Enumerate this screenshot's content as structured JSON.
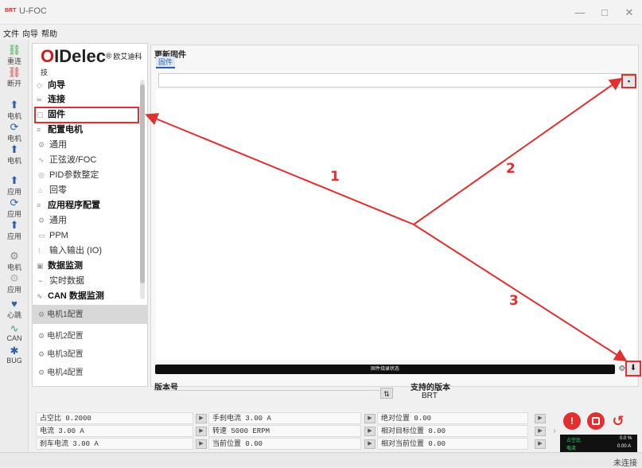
{
  "window": {
    "logo": "BRT",
    "title": "U-FOC",
    "minimize": "—",
    "maximize": "□",
    "close": "✕"
  },
  "menu": [
    "文件",
    "向导",
    "帮助"
  ],
  "toolbar": [
    {
      "icon": "link-icon",
      "glyph": "⛓",
      "label": "重连"
    },
    {
      "icon": "unlink-icon",
      "glyph": "⛓",
      "label": "断开"
    },
    {
      "icon": "upload-icon",
      "glyph": "⬆",
      "label": "电机"
    },
    {
      "icon": "refresh-icon",
      "glyph": "⟳",
      "label": "电机"
    },
    {
      "icon": "upload-icon",
      "glyph": "⬆",
      "label": "电机"
    },
    {
      "icon": "upload-icon",
      "glyph": "⬆",
      "label": "应用"
    },
    {
      "icon": "refresh-icon",
      "glyph": "⟳",
      "label": "应用"
    },
    {
      "icon": "upload-icon",
      "glyph": "⬆",
      "label": "应用"
    },
    {
      "icon": "motor-icon",
      "glyph": "⚙",
      "label": "电机"
    },
    {
      "icon": "app-icon",
      "glyph": "⚙",
      "label": "应用"
    },
    {
      "icon": "heart-icon",
      "glyph": "♥",
      "label": "心跳"
    },
    {
      "icon": "can-icon",
      "glyph": "∿",
      "label": "CAN"
    },
    {
      "icon": "bug-icon",
      "glyph": "✱",
      "label": "BUG"
    }
  ],
  "brand": {
    "name_first": "O",
    "name_rest": "IDelec",
    "reg": "®",
    "cn": "欧艾迪科技"
  },
  "nav": [
    {
      "label": "向导",
      "bold": true,
      "glyph": "◇"
    },
    {
      "label": "连接",
      "bold": true,
      "glyph": "∞"
    },
    {
      "label": "固件",
      "bold": true,
      "glyph": "▢"
    },
    {
      "label": "配置电机",
      "bold": true,
      "glyph": "≡"
    },
    {
      "label": "通用",
      "bold": false,
      "glyph": "⚙"
    },
    {
      "label": "正弦波/FOC",
      "bold": false,
      "glyph": "∿"
    },
    {
      "label": "PID参数整定",
      "bold": false,
      "glyph": "◎"
    },
    {
      "label": "回零",
      "bold": false,
      "glyph": "⌂"
    },
    {
      "label": "应用程序配置",
      "bold": true,
      "glyph": "≡"
    },
    {
      "label": "通用",
      "bold": false,
      "glyph": "⚙"
    },
    {
      "label": "PPM",
      "bold": false,
      "glyph": "▭"
    },
    {
      "label": "输入输出 (IO)",
      "bold": false,
      "glyph": "⁞"
    },
    {
      "label": "数据监测",
      "bold": true,
      "glyph": "▣"
    },
    {
      "label": "实时数据",
      "bold": false,
      "glyph": "⌁"
    },
    {
      "label": "CAN 数据监测",
      "bold": true,
      "glyph": "∿"
    }
  ],
  "motors": [
    "电机1配置",
    "电机2配置",
    "电机3配置",
    "电机4配置"
  ],
  "main": {
    "section_title": "更新固件",
    "tab": "固件",
    "open_icon": "▪",
    "progress_text": "固件烧录状态",
    "gear_icon": "⚙",
    "download_icon": "⬇",
    "version_label": "版本号",
    "version_btn": "⇅",
    "supported_label": "支持的版本",
    "supported_value": "BRT"
  },
  "status": {
    "col1": [
      "占空比 0.2000",
      "电流 3.00 A",
      "刹车电流 3.00 A"
    ],
    "col2": [
      "手刹电流 3.00 A",
      "转速 5000 ERPM",
      "当前位置 0.00"
    ],
    "col3": [
      "绝对位置 0.00",
      "相对目标位置 0.00",
      "相对当前位置 0.00"
    ],
    "more": "›"
  },
  "controls": {
    "estop": "!",
    "reset": "↺"
  },
  "meters": {
    "m1_label": "占空比",
    "m1_value": "0.0 %",
    "m2_label": "电流",
    "m2_value": "0.00 A"
  },
  "statusbar": {
    "right": "未连接"
  },
  "annotations": {
    "n1": "1",
    "n2": "2",
    "n3": "3",
    "color": "#e0302f"
  }
}
